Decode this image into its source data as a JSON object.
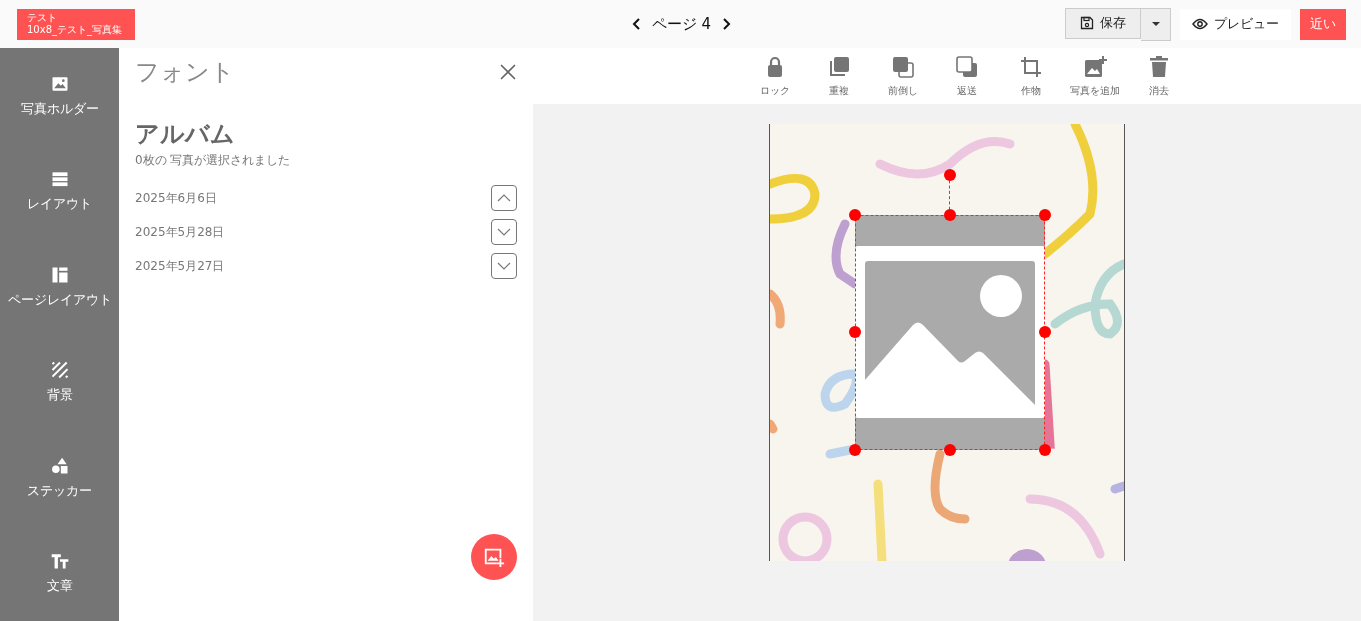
{
  "project_badge": {
    "lines": [
      "テスト",
      "10x8_テスト_写真集"
    ]
  },
  "page_nav": {
    "label": "ページ 4"
  },
  "actions": {
    "save": "保存",
    "preview": "プレビュー",
    "close": "近い"
  },
  "sidebar": {
    "items": [
      {
        "kind": "photo",
        "label": "写真ホルダー"
      },
      {
        "kind": "layout",
        "label": "レイアウト"
      },
      {
        "kind": "page_layout",
        "label": "ページレイアウト"
      },
      {
        "kind": "background",
        "label": "背景"
      },
      {
        "kind": "sticker",
        "label": "ステッカー"
      },
      {
        "kind": "text",
        "label": "文章"
      }
    ]
  },
  "panel": {
    "title": "フォント",
    "album_title": "アルバム",
    "selection_note": "0枚の 写真が選択されました",
    "dates": [
      {
        "label": "2025年6月6日",
        "expanded": true
      },
      {
        "label": "2025年5月28日",
        "expanded": false
      },
      {
        "label": "2025年5月27日",
        "expanded": false
      }
    ]
  },
  "toolbar": [
    {
      "kind": "lock",
      "label": "ロック"
    },
    {
      "kind": "duplicate",
      "label": "重複"
    },
    {
      "kind": "bring_forward",
      "label": "前倒し"
    },
    {
      "kind": "send_back",
      "label": "返送"
    },
    {
      "kind": "crop",
      "label": "作物"
    },
    {
      "kind": "add_photo",
      "label": "写真を追加"
    },
    {
      "kind": "delete",
      "label": "消去"
    }
  ]
}
